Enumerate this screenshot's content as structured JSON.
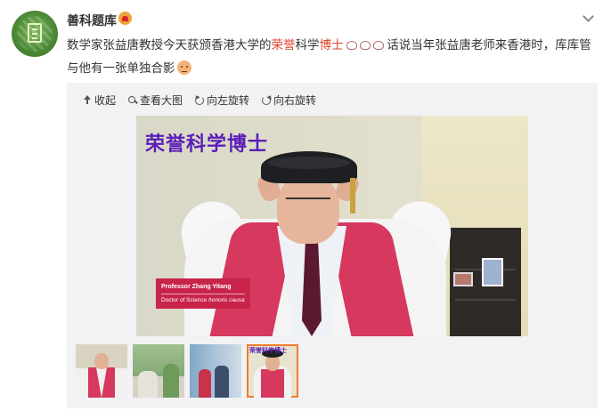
{
  "post": {
    "username": "善科题库",
    "text_part1": "数学家张益唐教授今天获颁香港大学的",
    "highlight_1": "荣誉",
    "text_part2": "科学",
    "highlight_2": "博士",
    "text_part3": " 话说当年张益唐老师来香港时，库库管与他有一张单独合影"
  },
  "toolbar": {
    "collapse": "收起",
    "view_large": "查看大图",
    "rotate_left": "向左旋转",
    "rotate_right": "向右旋转"
  },
  "main_image": {
    "title": "荣誉科学博士",
    "caption_name": "Professor Zhang Yitang",
    "caption_degree_prefix": "Doctor of Science ",
    "caption_degree_italic": "honoris causa"
  },
  "thumbnails": {
    "active_index": 3,
    "active_title": "荣誉科学博士"
  },
  "colors": {
    "highlight": "#e0452b",
    "title_purple": "#5a1fb8",
    "caption_red": "#c8244a",
    "active_border": "#ef7d2d"
  }
}
